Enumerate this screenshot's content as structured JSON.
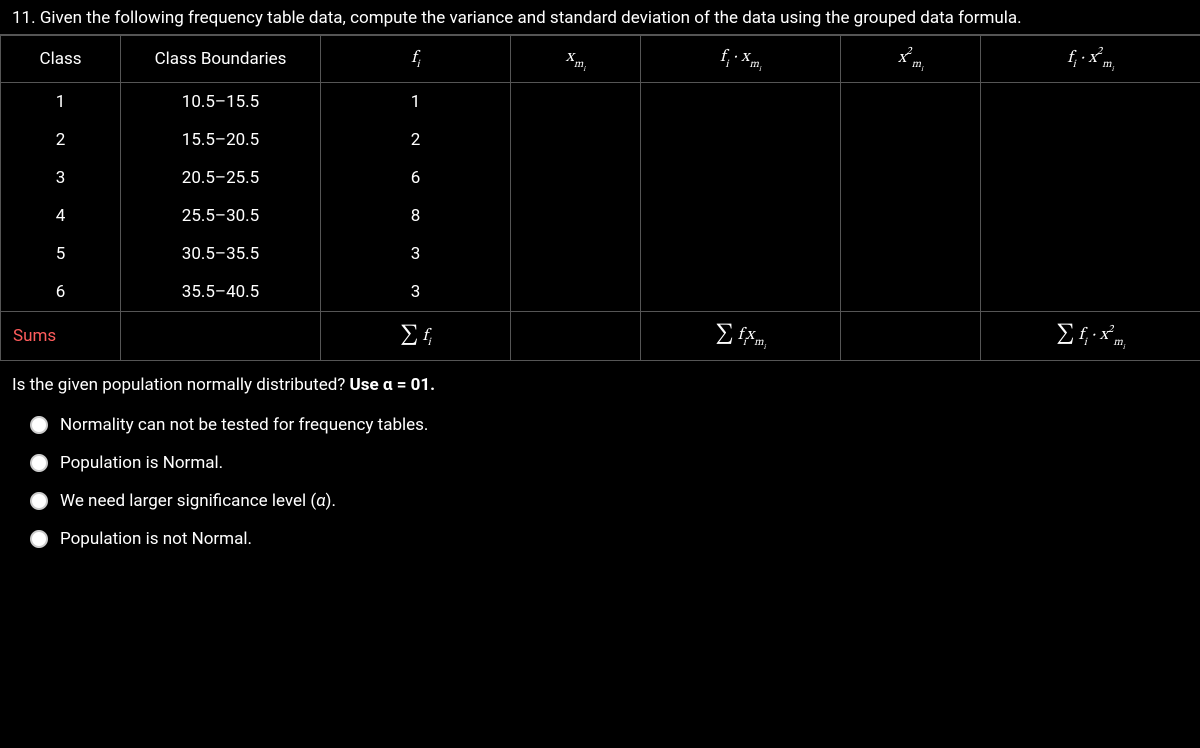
{
  "question_number": "11.",
  "question_text": "Given the following frequency table data, compute the variance and standard deviation of the data using the grouped data formula.",
  "headers": {
    "class": "Class",
    "boundaries": "Class Boundaries",
    "fi": "f",
    "fi_sub": "i",
    "xmi": "x",
    "xmi_sub": "m",
    "xmi_sub2": "i",
    "fixmi": "f",
    "fixmi_sub": "i",
    "fixmi_dot": " · ",
    "fixmi_x": "x",
    "fixmi_xsub": "m",
    "fixmi_xsub2": "i",
    "xmi2": "x",
    "xmi2_sup": "2",
    "xmi2_sub": "m",
    "xmi2_sub2": "i",
    "fixmi2": "f",
    "fixmi2_sub": "i",
    "fixmi2_dot": " · ",
    "fixmi2_x": "x",
    "fixmi2_sup": "2",
    "fixmi2_xsub": "m",
    "fixmi2_xsub2": "i"
  },
  "rows": [
    {
      "class": "1",
      "boundaries": "10.5–15.5",
      "fi": "1"
    },
    {
      "class": "2",
      "boundaries": "15.5–20.5",
      "fi": "2"
    },
    {
      "class": "3",
      "boundaries": "20.5–25.5",
      "fi": "6"
    },
    {
      "class": "4",
      "boundaries": "25.5–30.5",
      "fi": "8"
    },
    {
      "class": "5",
      "boundaries": "30.5–35.5",
      "fi": "3"
    },
    {
      "class": "6",
      "boundaries": "35.5–40.5",
      "fi": "3"
    }
  ],
  "sums_label": "Sums",
  "sums": {
    "sigma": "∑",
    "f": "f",
    "fsub": "i",
    "x": "x",
    "xsub": "m",
    "xsub2": "i",
    "sup2": "2",
    "dot": " · "
  },
  "followup": {
    "text": "Is the given population normally distributed? ",
    "bold": "Use α = 01."
  },
  "options": [
    "Normality can not be tested for frequency tables.",
    "Population is Normal.",
    "We need larger significance level (α).",
    "Population is not Normal."
  ]
}
